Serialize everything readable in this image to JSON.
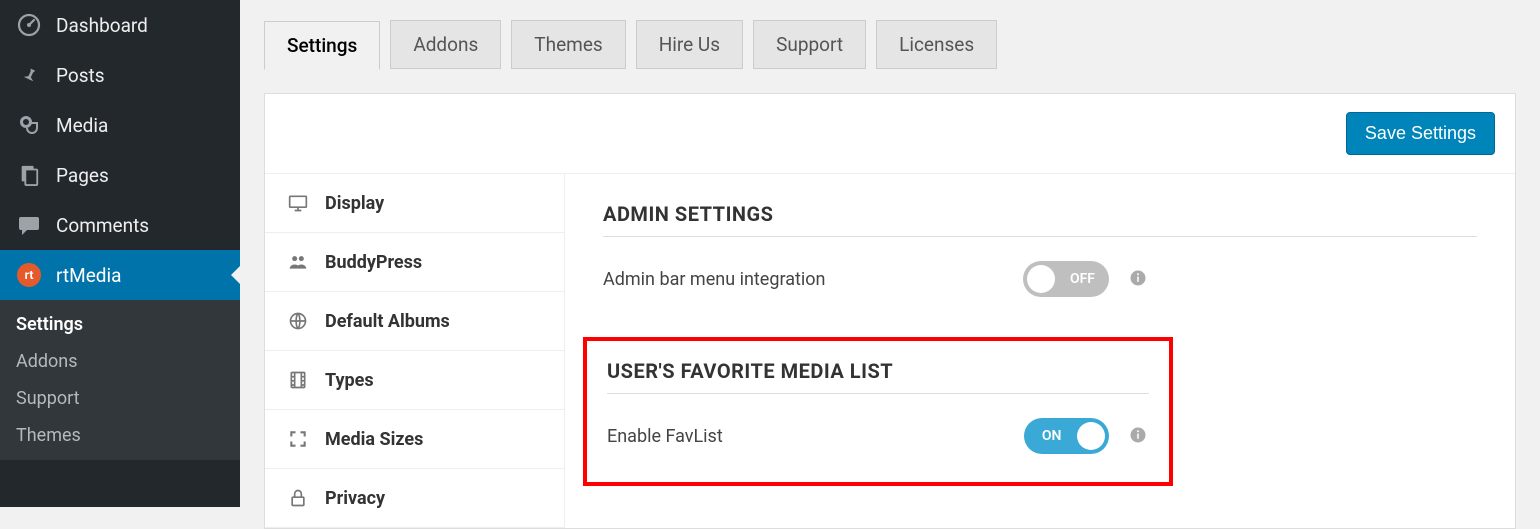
{
  "sidebar": {
    "items": [
      {
        "label": "Dashboard"
      },
      {
        "label": "Posts"
      },
      {
        "label": "Media"
      },
      {
        "label": "Pages"
      },
      {
        "label": "Comments"
      },
      {
        "label": "rtMedia"
      }
    ],
    "subitems": [
      {
        "label": "Settings"
      },
      {
        "label": "Addons"
      },
      {
        "label": "Support"
      },
      {
        "label": "Themes"
      }
    ]
  },
  "tabs": [
    {
      "label": "Settings"
    },
    {
      "label": "Addons"
    },
    {
      "label": "Themes"
    },
    {
      "label": "Hire Us"
    },
    {
      "label": "Support"
    },
    {
      "label": "Licenses"
    }
  ],
  "actions": {
    "save": "Save Settings"
  },
  "settings_nav": [
    {
      "label": "Display"
    },
    {
      "label": "BuddyPress"
    },
    {
      "label": "Default Albums"
    },
    {
      "label": "Types"
    },
    {
      "label": "Media Sizes"
    },
    {
      "label": "Privacy"
    }
  ],
  "content": {
    "admin_section": {
      "title": "ADMIN SETTINGS",
      "row_label": "Admin bar menu integration",
      "toggle_state": "off",
      "toggle_text": "OFF"
    },
    "favlist_section": {
      "title": "USER'S FAVORITE MEDIA LIST",
      "row_label": "Enable FavList",
      "toggle_state": "on",
      "toggle_text": "ON"
    }
  }
}
